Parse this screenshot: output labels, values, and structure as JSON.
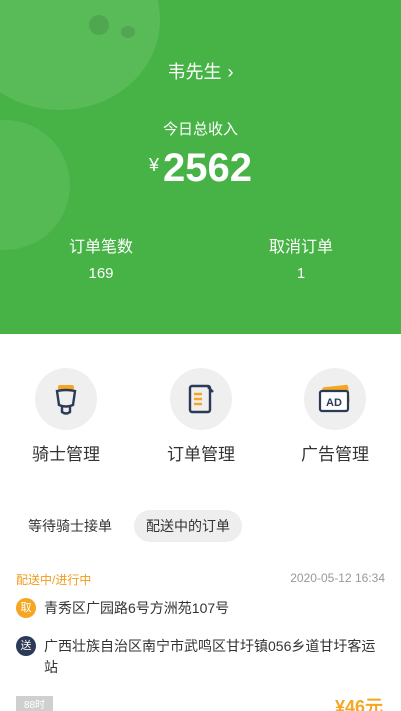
{
  "header": {
    "username": "韦先生",
    "income_label": "今日总收入",
    "currency": "¥",
    "income_amount": "2562",
    "stats": {
      "orders_label": "订单笔数",
      "orders_value": "169",
      "cancel_label": "取消订单",
      "cancel_value": "1"
    },
    "brand_color": "#47b346"
  },
  "functions": [
    {
      "label": "骑士管理",
      "icon": "scooter-icon"
    },
    {
      "label": "订单管理",
      "icon": "document-icon"
    },
    {
      "label": "广告管理",
      "icon": "ad-icon"
    }
  ],
  "tabs": [
    {
      "label": "等待骑士接单",
      "active": false
    },
    {
      "label": "配送中的订单",
      "active": true
    }
  ],
  "order": {
    "status": "配送中/进行中",
    "time": "2020-05-12 16:34",
    "pickup_badge": "取",
    "pickup_address": "青秀区广园路6号方洲苑107号",
    "send_badge": "送",
    "send_address": "广西壮族自治区南宁市武鸣区甘圩镇056乡道甘圩客运站",
    "timer_label": "88时",
    "price": "¥46元",
    "accent_color": "#f5a623"
  }
}
